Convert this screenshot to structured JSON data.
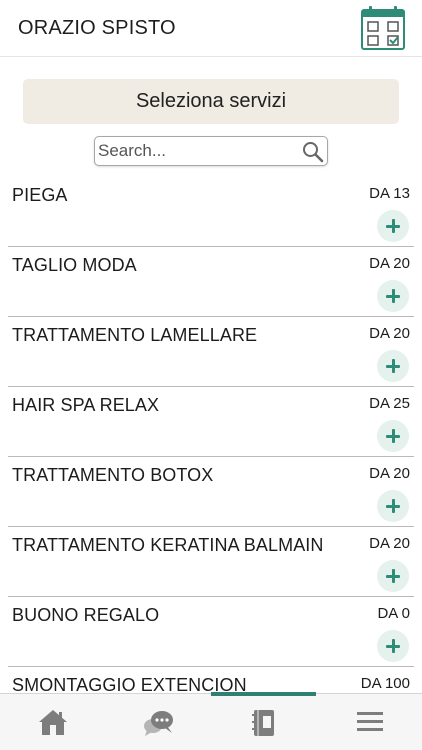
{
  "header": {
    "title": "ORAZIO SPISTO",
    "calendar_icon": "calendar-check-icon",
    "accent_color": "#2e8b78"
  },
  "main": {
    "select_services_label": "Seleziona servizi",
    "search": {
      "placeholder": "Search...",
      "value": ""
    },
    "services": [
      {
        "name": "PIEGA",
        "price": "DA 13"
      },
      {
        "name": "TAGLIO MODA",
        "price": "DA 20"
      },
      {
        "name": "TRATTAMENTO LAMELLARE",
        "price": "DA 20"
      },
      {
        "name": "HAIR SPA RELAX",
        "price": "DA 25"
      },
      {
        "name": "TRATTAMENTO BOTOX",
        "price": "DA 20"
      },
      {
        "name": "TRATTAMENTO KERATINA BALMAIN",
        "price": "DA 20"
      },
      {
        "name": "BUONO REGALO",
        "price": "DA 0"
      },
      {
        "name": "SMONTAGGIO EXTENCION",
        "price": "DA 100"
      }
    ]
  },
  "tabbar": {
    "tabs": [
      {
        "icon": "home-icon",
        "selected": false
      },
      {
        "icon": "chat-icon",
        "selected": false
      },
      {
        "icon": "booking-book-icon",
        "selected": true
      },
      {
        "icon": "menu-icon",
        "selected": false
      }
    ]
  }
}
